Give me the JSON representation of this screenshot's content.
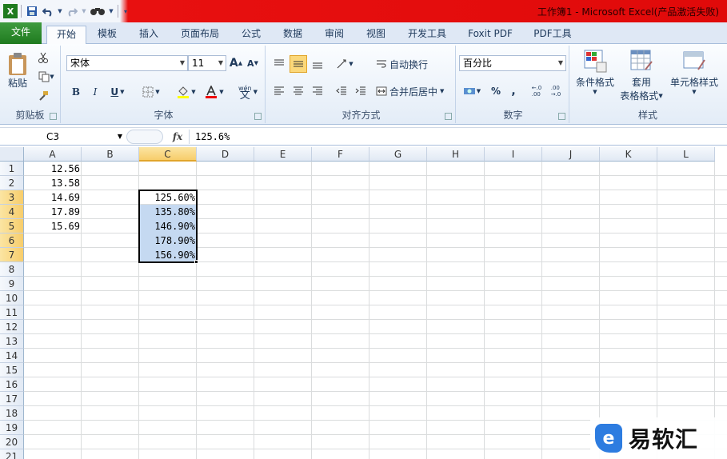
{
  "app": {
    "title": "工作簿1 - Microsoft Excel(产品激活失败)",
    "qat_icons": [
      "excel-logo-icon",
      "save-icon",
      "undo-icon",
      "redo-icon",
      "binoculars-icon",
      "customize-qat-icon"
    ]
  },
  "tabs": [
    {
      "label": "文件",
      "active": false
    },
    {
      "label": "开始",
      "active": true
    },
    {
      "label": "模板",
      "active": false
    },
    {
      "label": "插入",
      "active": false
    },
    {
      "label": "页面布局",
      "active": false
    },
    {
      "label": "公式",
      "active": false
    },
    {
      "label": "数据",
      "active": false
    },
    {
      "label": "审阅",
      "active": false
    },
    {
      "label": "视图",
      "active": false
    },
    {
      "label": "开发工具",
      "active": false
    },
    {
      "label": "Foxit PDF",
      "active": false
    },
    {
      "label": "PDF工具",
      "active": false
    }
  ],
  "ribbon": {
    "clipboard": {
      "label": "剪贴板",
      "paste": "粘贴"
    },
    "font": {
      "label": "字体",
      "name": "宋体",
      "size": "11",
      "bold": "B",
      "italic": "I",
      "underline": "U",
      "grow": "A",
      "shrink": "A",
      "wen": "wén"
    },
    "alignment": {
      "label": "对齐方式",
      "wrap": "自动换行",
      "merge": "合并后居中"
    },
    "number": {
      "label": "数字",
      "format": "百分比",
      "percent": "%",
      "comma": ",",
      "inc_decimal": "←.0\n.00",
      "dec_decimal": ".00\n→.0"
    },
    "styles": {
      "label": "样式",
      "conditional": "条件格式",
      "table_1": "套用",
      "table_2": "表格格式",
      "cell_styles": "单元格样式"
    }
  },
  "formula_bar": {
    "name_box": "C3",
    "fx": "fx",
    "content": "125.6%"
  },
  "columns": [
    "A",
    "B",
    "C",
    "D",
    "E",
    "F",
    "G",
    "H",
    "I",
    "J",
    "K",
    "L"
  ],
  "rows": [
    "1",
    "2",
    "3",
    "4",
    "5",
    "6",
    "7",
    "8",
    "9",
    "10",
    "11",
    "12",
    "13",
    "14",
    "15",
    "16",
    "17",
    "18",
    "19",
    "20",
    "21"
  ],
  "cells": {
    "A": [
      "12.56",
      "13.58",
      "14.69",
      "17.89",
      "15.69"
    ],
    "C": [
      "125.60%",
      "135.80%",
      "146.90%",
      "178.90%",
      "156.90%"
    ]
  },
  "selection": {
    "active_col": "C",
    "rows": [
      "3",
      "4",
      "5",
      "6",
      "7"
    ]
  },
  "watermark": {
    "text": "易软汇",
    "logo_letter": "e"
  },
  "colors": {
    "file_tab": "#2e8b2e",
    "title_red": "#e00a0a",
    "selection_fill": "#c5d9f1",
    "header_selected": "#f7cd6b"
  }
}
